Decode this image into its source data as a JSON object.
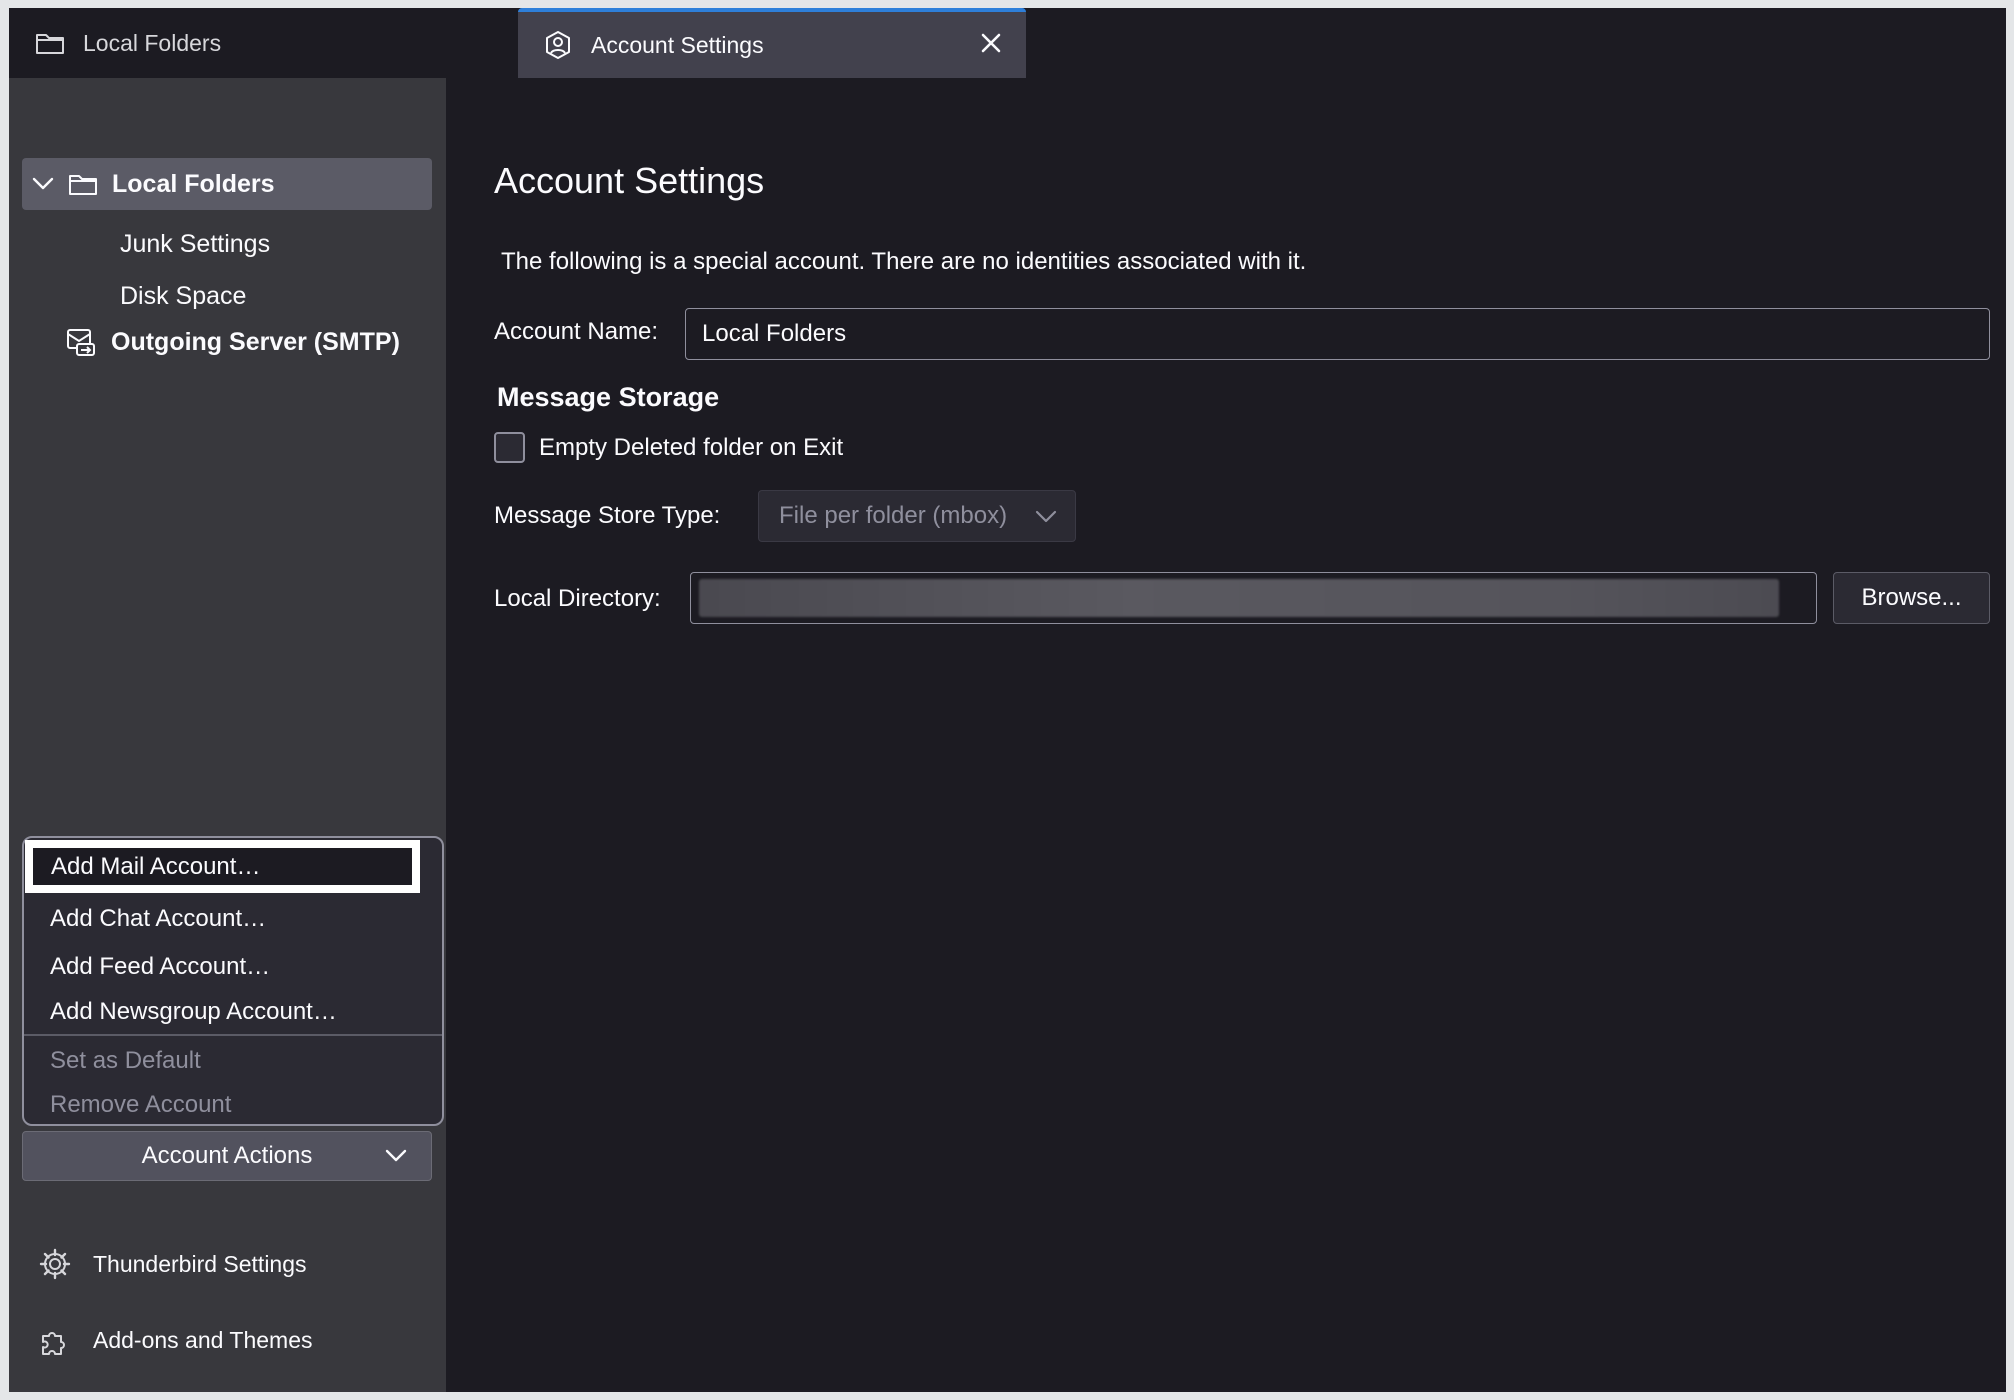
{
  "tabs": [
    {
      "label": "Local Folders",
      "icon": "folder-icon"
    },
    {
      "label": "Account Settings",
      "icon": "account-icon",
      "active": true
    }
  ],
  "sidebar": {
    "tree": {
      "account": "Local Folders",
      "children": [
        "Junk Settings",
        "Disk Space"
      ],
      "smtp": "Outgoing Server (SMTP)"
    },
    "menu": {
      "items": [
        "Add Mail Account…",
        "Add Chat Account…",
        "Add Feed Account…",
        "Add Newsgroup Account…"
      ],
      "disabled_items": [
        "Set as Default",
        "Remove Account"
      ]
    },
    "actions_button": "Account Actions",
    "footer": {
      "settings": "Thunderbird Settings",
      "addons": "Add-ons and Themes"
    }
  },
  "main": {
    "title": "Account Settings",
    "description": "The following is a special account. There are no identities associated with it.",
    "account_name_label": "Account Name:",
    "account_name_value": "Local Folders",
    "message_storage_title": "Message Storage",
    "empty_deleted_label": "Empty Deleted folder on Exit",
    "store_type_label": "Message Store Type:",
    "store_type_value": "File per folder (mbox)",
    "local_directory_label": "Local Directory:",
    "browse_button": "Browse..."
  },
  "colors": {
    "accent": "#2e7fd9",
    "sidebar_bg": "#38383d",
    "content_bg": "#1c1b22",
    "selected_row": "#5b5b66"
  }
}
